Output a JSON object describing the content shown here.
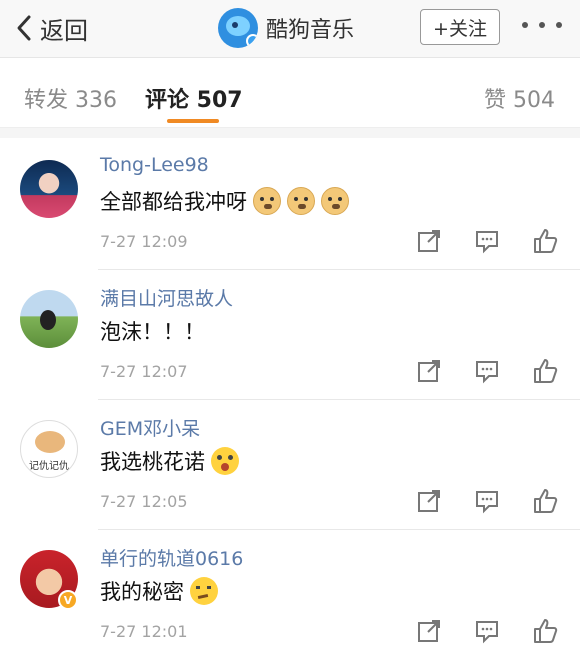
{
  "nav": {
    "back_label": "返回",
    "title": "酷狗音乐",
    "follow_label": "+关注"
  },
  "tabs": [
    {
      "label": "转发 336"
    },
    {
      "label": "评论 507"
    },
    {
      "label": "赞 504"
    }
  ],
  "comments": [
    {
      "user": "Tong-Lee98",
      "text": "全部都给我冲呀",
      "emoji": [
        "doge-emoji",
        "doge-emoji",
        "doge-emoji"
      ],
      "time": "7-27 12:09"
    },
    {
      "user": "满目山河思故人",
      "text": "泡沫！！！",
      "emoji": [],
      "time": "7-27 12:07"
    },
    {
      "user": "GEM邓小呆",
      "text": "我选桃花诺",
      "emoji": [
        "shocked-emoji"
      ],
      "time": "7-27 12:05"
    },
    {
      "user": "单行的轨道0616",
      "text": "我的秘密",
      "emoji": [
        "thinking-emoji"
      ],
      "time": "7-27 12:01"
    }
  ],
  "avatar3_text": "记仇记仇"
}
